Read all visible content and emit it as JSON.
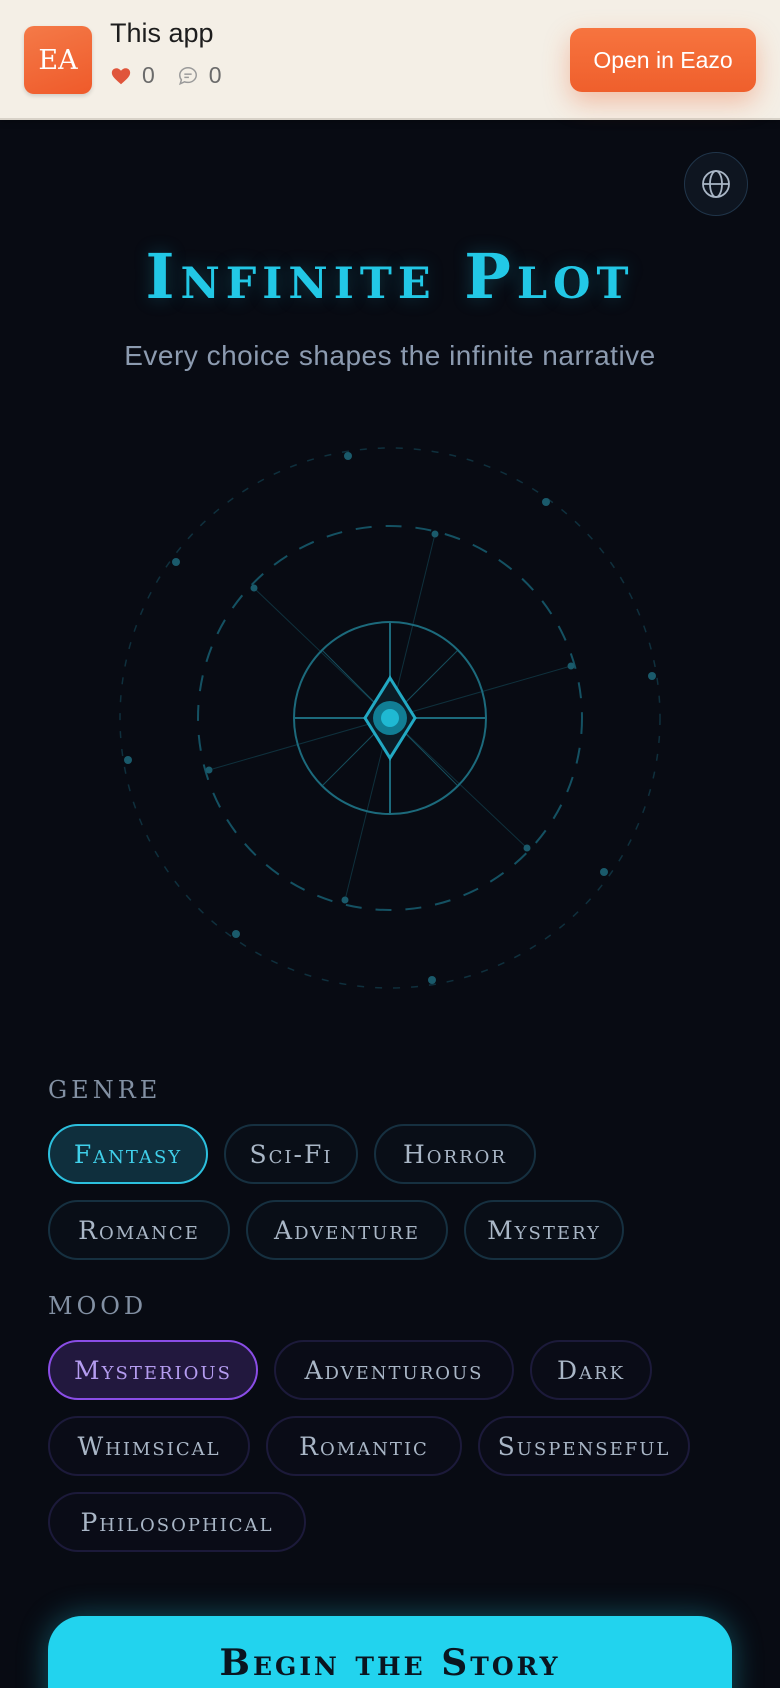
{
  "topbar": {
    "logo_text": "EA",
    "title": "This app",
    "likes": "0",
    "comments": "0",
    "open_label": "Open in Eazo"
  },
  "hero": {
    "title": "Infinite Plot",
    "subtitle": "Every choice shapes the infinite narrative"
  },
  "genre": {
    "label": "GENRE",
    "options": [
      "Fantasy",
      "Sci-Fi",
      "Horror",
      "Romance",
      "Adventure",
      "Mystery"
    ],
    "selected": "Fantasy"
  },
  "mood": {
    "label": "MOOD",
    "options": [
      "Mysterious",
      "Adventurous",
      "Dark",
      "Whimsical",
      "Romantic",
      "Suspenseful",
      "Philosophical"
    ],
    "selected": "Mysterious"
  },
  "cta": {
    "label": "Begin the Story"
  },
  "colors": {
    "accent": "#22d3ee",
    "mood_accent": "#8a4de6",
    "brand": "#ef5f2c",
    "background": "#080b13"
  },
  "icons": [
    "heart-icon",
    "comment-icon",
    "globe-icon",
    "compass-icon"
  ]
}
